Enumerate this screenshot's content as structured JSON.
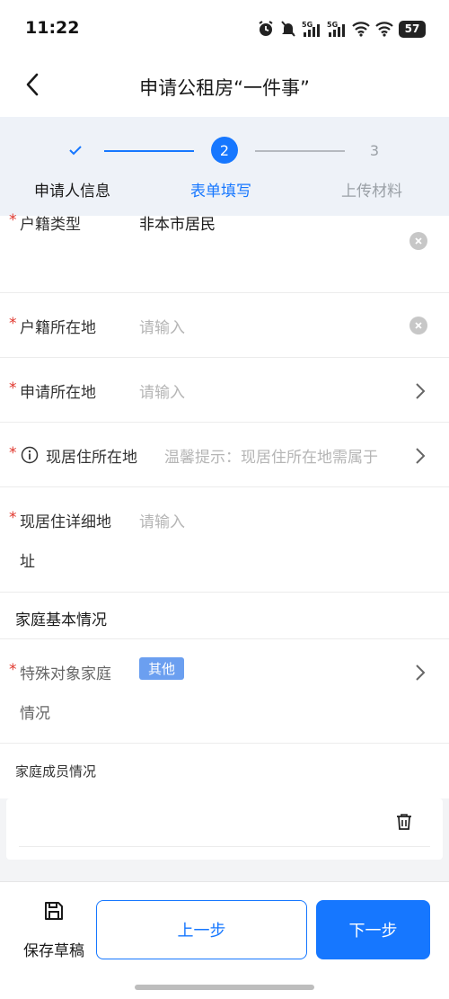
{
  "status_bar": {
    "time": "11:22",
    "battery": "57",
    "icons": [
      "alarm-icon",
      "mute-bell-icon",
      "signal-5g-icon",
      "signal-5g-icon",
      "wifi-icon",
      "wifi-icon",
      "battery-icon"
    ]
  },
  "header": {
    "title": "申请公租房“一件事”"
  },
  "stepper": {
    "steps": [
      {
        "label": "申请人信息",
        "state": "done"
      },
      {
        "number": "2",
        "label": "表单填写",
        "state": "active"
      },
      {
        "number": "3",
        "label": "上传材料",
        "state": "pending"
      }
    ]
  },
  "form": {
    "rows": [
      {
        "label": "户籍类型",
        "value": "非本市居民",
        "control": "clear"
      },
      {
        "label": "户籍所在地",
        "placeholder": "请输入",
        "control": "clear"
      },
      {
        "label": "申请所在地",
        "placeholder": "请输入",
        "control": "chevron"
      },
      {
        "label": "现居住所在地",
        "placeholder": "温馨提示：现居住所在地需属于",
        "control": "chevron",
        "info_icon": true
      },
      {
        "label_line1": "现居住详细地",
        "label_line2": "址",
        "placeholder": "请输入"
      }
    ],
    "section_family": "家庭基本情况",
    "special_family": {
      "label_line1": "特殊对象家庭",
      "label_line2": "情况",
      "tag": "其他"
    },
    "members_title": "家庭成员情况"
  },
  "bottom": {
    "save_label": "保存草稿",
    "prev_label": "上一步",
    "next_label": "下一步"
  },
  "colors": {
    "accent": "#1677ff",
    "required": "#e0352b",
    "stepper_bg": "#eef2f8",
    "tag_bg": "#6b9ff0"
  }
}
